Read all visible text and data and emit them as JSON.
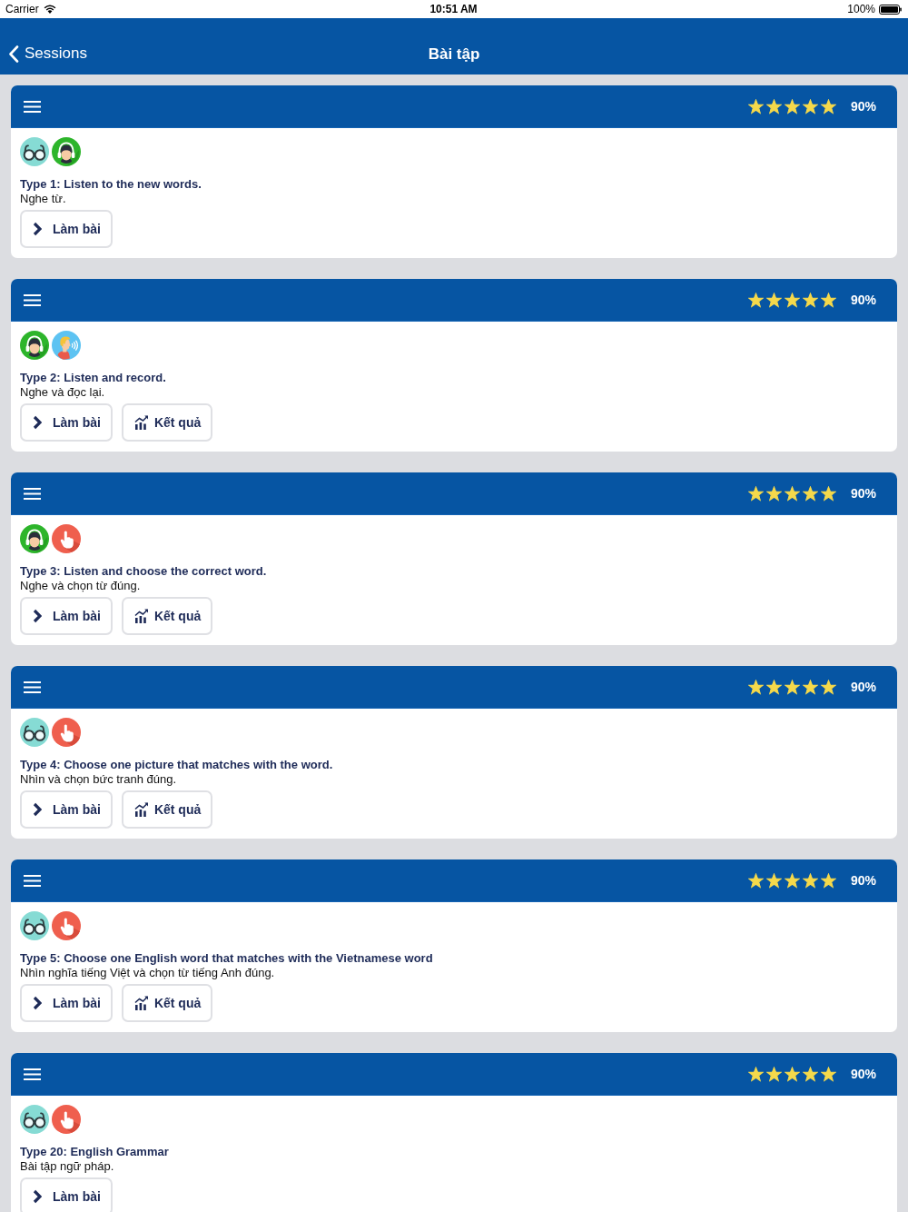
{
  "status_bar": {
    "carrier": "Carrier",
    "time": "10:51 AM",
    "battery": "100%"
  },
  "nav_bar": {
    "back_label": "Sessions",
    "title": "Bài tập"
  },
  "exercises": [
    {
      "stars": 5,
      "score": "90%",
      "icons": [
        {
          "kind": "glasses"
        },
        {
          "kind": "headphones"
        }
      ],
      "title": "Type 1: Listen to the new words.",
      "subtitle": "Nghe từ.",
      "buttons": [
        {
          "kind": "do",
          "label": "Làm bài"
        }
      ]
    },
    {
      "stars": 5,
      "score": "90%",
      "icons": [
        {
          "kind": "headphones"
        },
        {
          "kind": "speaking"
        }
      ],
      "title": "Type 2: Listen and record.",
      "subtitle": "Nghe và đọc lại.",
      "buttons": [
        {
          "kind": "do",
          "label": "Làm bài"
        },
        {
          "kind": "result",
          "label": "Kết quả"
        }
      ]
    },
    {
      "stars": 5,
      "score": "90%",
      "icons": [
        {
          "kind": "headphones"
        },
        {
          "kind": "hand"
        }
      ],
      "title": "Type 3: Listen and choose the correct word.",
      "subtitle": "Nghe và chọn từ đúng.",
      "buttons": [
        {
          "kind": "do",
          "label": "Làm bài"
        },
        {
          "kind": "result",
          "label": "Kết quả"
        }
      ]
    },
    {
      "stars": 5,
      "score": "90%",
      "icons": [
        {
          "kind": "glasses"
        },
        {
          "kind": "hand"
        }
      ],
      "title": "Type 4: Choose one picture that matches with the word.",
      "subtitle": "Nhìn và chọn bức tranh đúng.",
      "buttons": [
        {
          "kind": "do",
          "label": "Làm bài"
        },
        {
          "kind": "result",
          "label": "Kết quả"
        }
      ]
    },
    {
      "stars": 5,
      "score": "90%",
      "icons": [
        {
          "kind": "glasses"
        },
        {
          "kind": "hand"
        }
      ],
      "title": "Type 5: Choose one English word that matches with the Vietnamese word",
      "subtitle": "Nhìn nghĩa tiếng Việt và chọn từ tiếng Anh đúng.",
      "buttons": [
        {
          "kind": "do",
          "label": "Làm bài"
        },
        {
          "kind": "result",
          "label": "Kết quả"
        }
      ]
    },
    {
      "stars": 5,
      "score": "90%",
      "icons": [
        {
          "kind": "glasses"
        },
        {
          "kind": "hand"
        }
      ],
      "title": "Type 20: English Grammar",
      "subtitle": "Bài tập ngữ pháp.",
      "buttons": [
        {
          "kind": "do",
          "label": "Làm bài"
        }
      ]
    }
  ]
}
